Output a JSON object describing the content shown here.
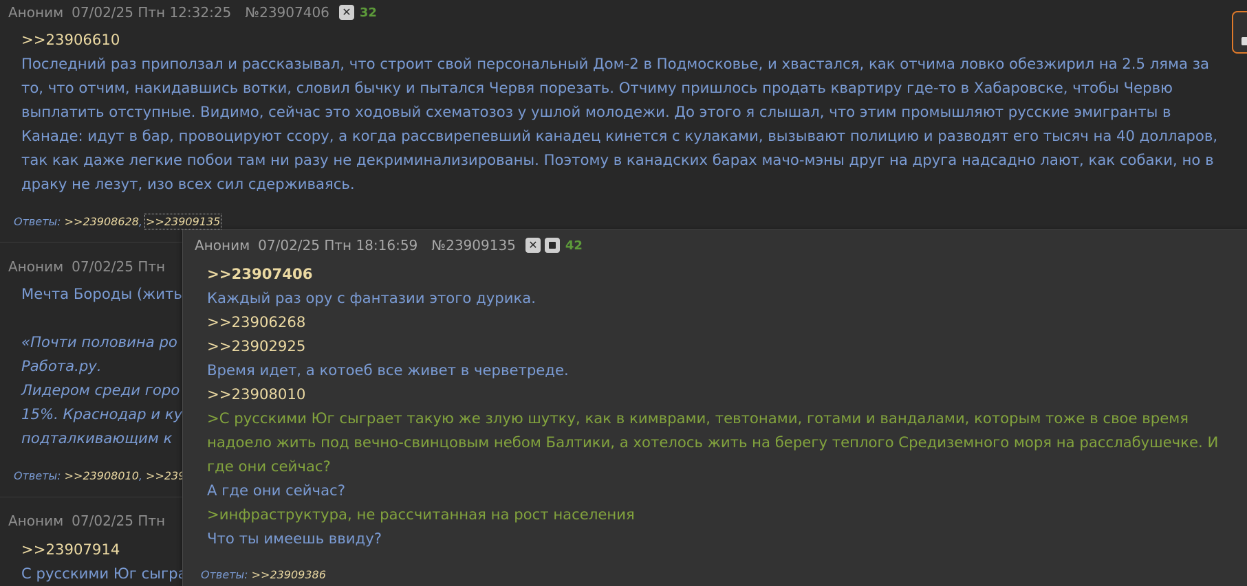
{
  "post1": {
    "name": "Аноним",
    "date": "07/02/25 Птн 12:32:25",
    "number": "№23907406",
    "count": "32",
    "reply_to": ">>23906610",
    "lines": [
      "Последний раз приползал и рассказывал, что строит свой персональный Дом-2 в Подмосковье, и хвастался, как отчима ловко обезжирил на 2.5 ляма за",
      "то, что отчим, накидавшись вотки, словил бычку и пытался Червя порезать. Отчиму пришлось продать квартиру где-то в Хабаровске, чтобы Червю",
      "выплатить отступные. Видимо, сейчас это ходовый схематозоз у ушлой молодежи. До этого я слышал, что этим промышляют русские эмигранты в",
      "Канаде: идут в бар, провоцируют ссору, а когда рассвирепевший канадец кинется с кулаками, вызывают полицию и разводят его тысяч на 40 долларов,",
      "так как даже легкие побои там ни разу не декриминализированы. Поэтому в канадских барах мачо-мэны друг на друга надсадно лают, как собаки, но в",
      "драку не лезут, изо всех сил сдерживаясь."
    ],
    "answers_label": "Ответы:",
    "answers": [
      ">>23908628",
      ">>23909135"
    ]
  },
  "post2": {
    "name": "Аноним",
    "date": "07/02/25 Птн",
    "line1": "Мечта Бороды (жить",
    "ital_lines": [
      "«Почти половина ро",
      "Работа.ру.",
      "Лидером среди горо",
      "15%. Краснодар и кур",
      "подталкивающим к"
    ],
    "answers_label": "Ответы:",
    "answers": [
      ">>23908010",
      ">>239"
    ]
  },
  "post3": {
    "name": "Аноним",
    "date": "07/02/25 Птн",
    "reply_to": ">>23907914",
    "line1": "С русскими Юг сыгра"
  },
  "popup": {
    "name": "Аноним",
    "date": "07/02/25 Птн 18:16:59",
    "number": "№23909135",
    "count": "42",
    "reply_main": ">>23907406",
    "line_a": "Каждый раз ору с фантазии этого дурика.",
    "reply_b": ">>23906268",
    "reply_c": ">>23902925",
    "line_b": "Время идет, а котоеб все живет в черветреде.",
    "reply_d": ">>23908010",
    "quote_lines": [
      ">С русскими Юг сыграет такую же злую шутку, как в кимврами, тевтонами, готами и вандалами, которым тоже в свое время",
      "надоело жить под вечно-свинцовым небом Балтики, а хотелось жить на берегу теплого Средиземного моря на расслабушечке. И",
      "где они сейчас?"
    ],
    "line_c": "А где они сейчас?",
    "quote2": ">инфраструктура, не рассчитанная на рост населения",
    "line_d": "Что ты имеешь ввиду?",
    "answers_label": "Ответы:",
    "answers": [
      ">>23909386"
    ]
  },
  "colors": {
    "background": "#282828",
    "popup_background": "#333333",
    "text_blue": "#7a9bd4",
    "reply_link": "#ebd9a2",
    "greentext": "#82a33d",
    "count_green": "#5d9b3a",
    "header_gray": "#8e8e8e",
    "accent_orange": "#e07a2a"
  },
  "icons": {
    "hide_icon": "x-square",
    "stop_icon": "square",
    "side_widget": "chat-icon"
  }
}
